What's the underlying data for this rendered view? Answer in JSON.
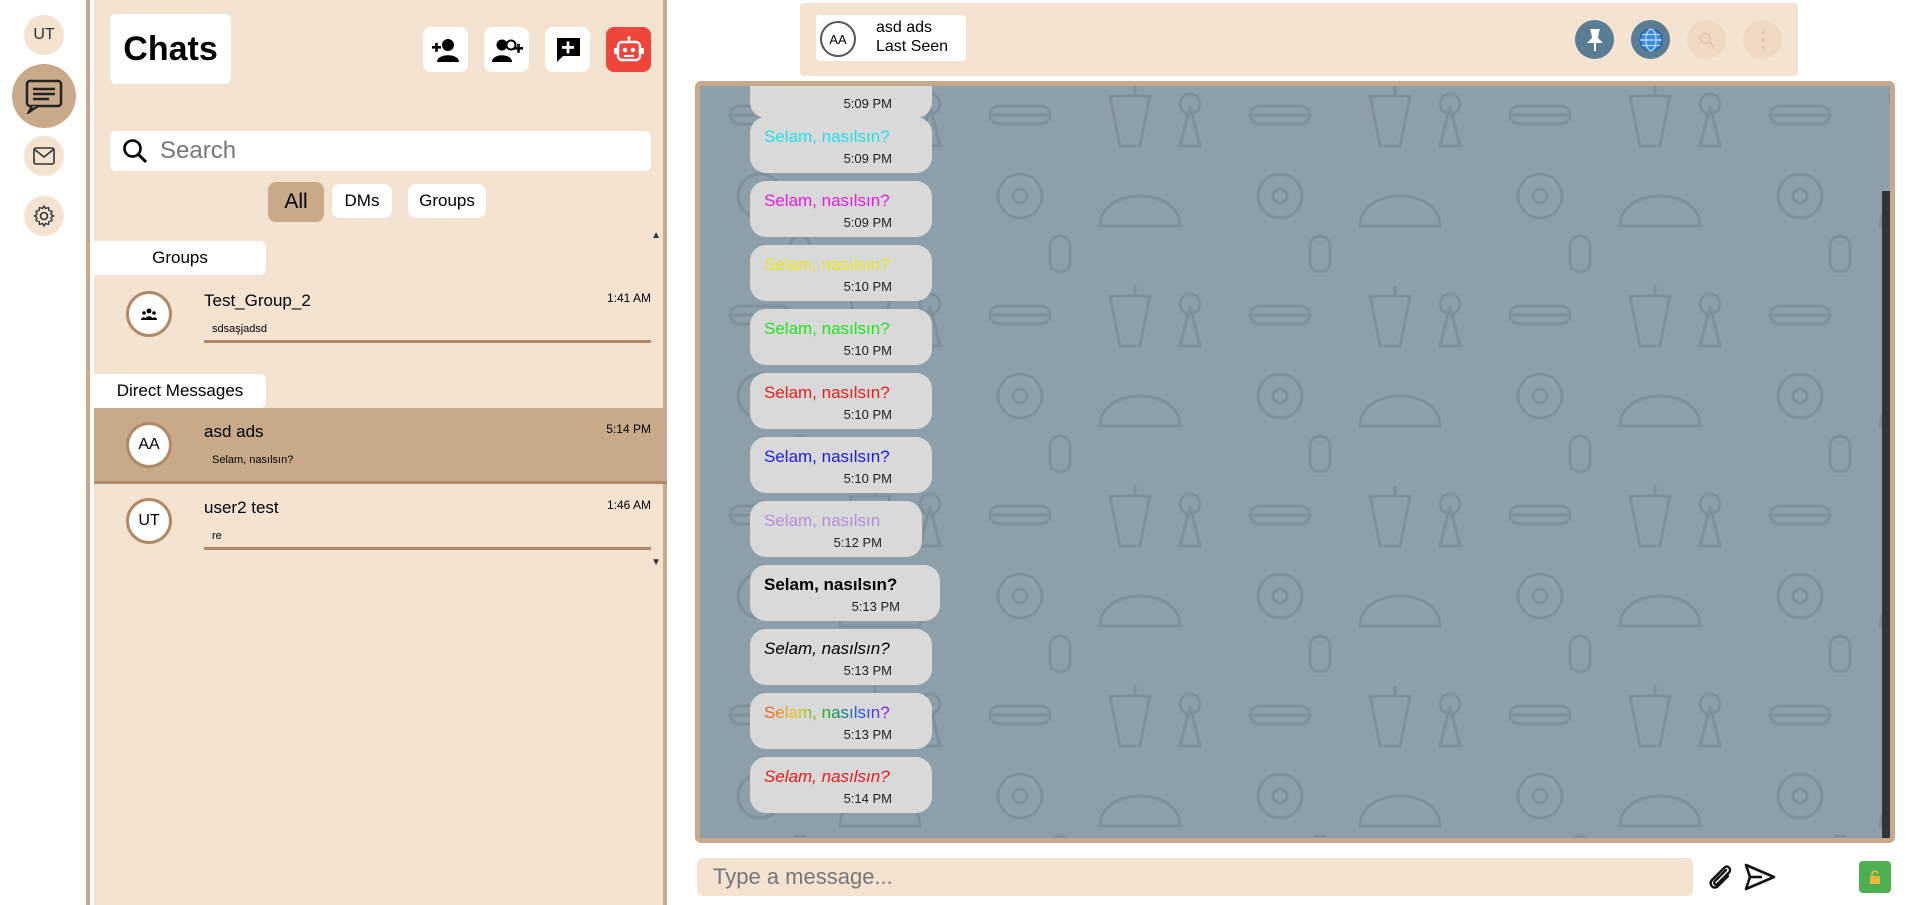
{
  "rail": {
    "user_initials": "UT",
    "items": [
      {
        "name": "chats",
        "icon": "chat-icon",
        "active": true
      },
      {
        "name": "mail",
        "icon": "mail-icon",
        "active": false
      },
      {
        "name": "settings",
        "icon": "gear-icon",
        "active": false
      }
    ]
  },
  "list": {
    "title": "Chats",
    "actions": [
      {
        "icon": "add-user-icon"
      },
      {
        "icon": "add-group-icon"
      },
      {
        "icon": "new-chat-icon"
      },
      {
        "icon": "bot-icon"
      }
    ],
    "search_placeholder": "Search",
    "filters": [
      "All",
      "DMs",
      "Groups"
    ],
    "active_filter": "All",
    "groups_label": "Groups",
    "groups": [
      {
        "name": "Test_Group_2",
        "time": "1:41 AM",
        "preview": "sdsaşjadsd"
      }
    ],
    "dms_label": "Direct Messages",
    "dms": [
      {
        "initials": "AA",
        "name": "asd ads",
        "time": "5:14 PM",
        "preview": "Selam, nasılsın?",
        "selected": true
      },
      {
        "initials": "UT",
        "name": "user2 test",
        "time": "1:46 AM",
        "preview": "re",
        "selected": false
      }
    ]
  },
  "header": {
    "initials": "AA",
    "name": "asd ads",
    "status": "Last Seen",
    "buttons": [
      {
        "icon": "pin-icon",
        "color": "#5b7d94"
      },
      {
        "icon": "globe-icon",
        "color": "#5b7d94"
      },
      {
        "icon": "search-icon",
        "color": "#f0d9c4"
      },
      {
        "icon": "more-icon",
        "color": "#f0d9c4"
      }
    ]
  },
  "messages": [
    {
      "text": "",
      "time": "5:09 PM",
      "color": "#000000"
    },
    {
      "text": "Selam, nasılsın?",
      "time": "5:09 PM",
      "color": "#22e0e8"
    },
    {
      "text": "Selam, nasılsın?",
      "time": "5:09 PM",
      "color": "#e81ce0"
    },
    {
      "text": "Selam, nasılsın?",
      "time": "5:10 PM",
      "color": "#e8e81c"
    },
    {
      "text": "Selam, nasılsın?",
      "time": "5:10 PM",
      "color": "#1ce81c"
    },
    {
      "text": "Selam, nasılsın?",
      "time": "5:10 PM",
      "color": "#e81c1c"
    },
    {
      "text": "Selam, nasılsın?",
      "time": "5:10 PM",
      "color": "#1c1ce8"
    },
    {
      "text": "Selam, nasılsın",
      "time": "5:12 PM",
      "color": "#b48fd8"
    },
    {
      "text": "Selam, nasılsın?",
      "time": "5:13 PM",
      "color": "#000000",
      "bold": true
    },
    {
      "text": "Selam, nasılsın?",
      "time": "5:13 PM",
      "color": "#000000",
      "italic": true
    },
    {
      "text": "Selam, nasılsın?",
      "time": "5:13 PM",
      "color": "rainbow"
    },
    {
      "text": "Selam, nasılsın?",
      "time": "5:14 PM",
      "color": "#e81c1c",
      "italic": true
    }
  ],
  "composer": {
    "placeholder": "Type a message...",
    "attach_icon": "paperclip-icon",
    "send_icon": "send-icon",
    "lock_icon": "lock-icon"
  }
}
